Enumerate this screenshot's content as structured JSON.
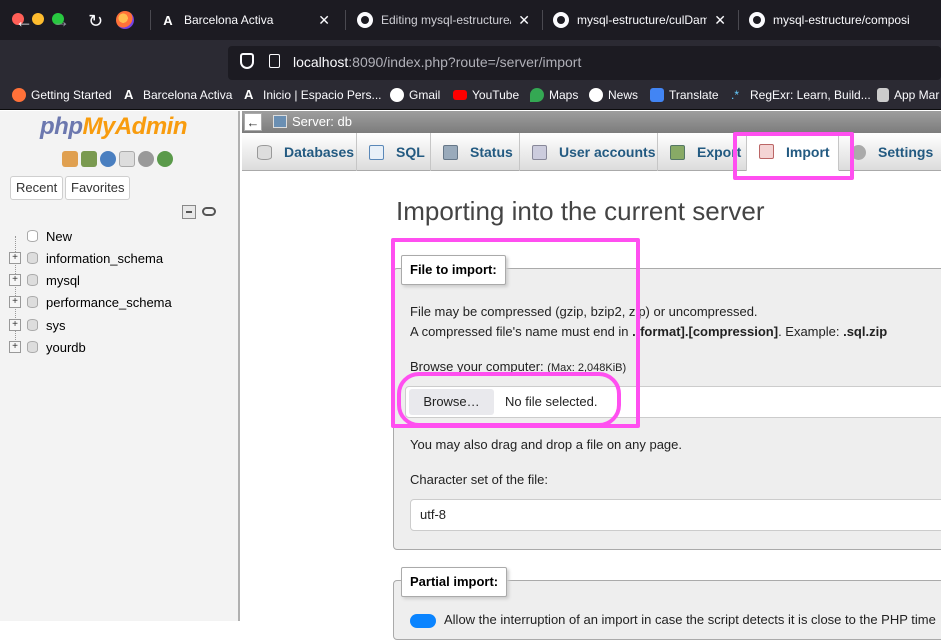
{
  "browser": {
    "tabs": [
      {
        "title": "Barcelona Activa"
      },
      {
        "title": "Editing mysql-estructure/R"
      },
      {
        "title": "mysql-estructure/culDamp"
      },
      {
        "title": "mysql-estructure/composi"
      }
    ],
    "url_host": "localhost",
    "url_rest": ":8090/index.php?route=/server/import",
    "bookmarks": [
      "Getting Started",
      "Barcelona Activa",
      "Inicio | Espacio Pers...",
      "Gmail",
      "YouTube",
      "Maps",
      "News",
      "Translate",
      "RegExr: Learn, Build...",
      "App Mar"
    ]
  },
  "sidebar": {
    "logo_php": "php",
    "logo_admin": "MyAdmin",
    "tabs": [
      "Recent",
      "Favorites"
    ],
    "tree": [
      "New",
      "information_schema",
      "mysql",
      "performance_schema",
      "sys",
      "yourdb"
    ]
  },
  "server_label": "Server: db",
  "menu": [
    "Databases",
    "SQL",
    "Status",
    "User accounts",
    "Export",
    "Import",
    "Settings"
  ],
  "page_title": "Importing into the current server",
  "file_import": {
    "legend": "File to import:",
    "compress_line": "File may be compressed (gzip, bzip2, zip) or uncompressed.",
    "name_line_pre": "A compressed file's name must end in ",
    "name_line_bold": ".[format].[compression]",
    "name_line_mid": ". Example: ",
    "name_line_example": ".sql.zip",
    "browse_label": "Browse your computer: ",
    "max_size": "(Max: 2,048KiB)",
    "browse_button": "Browse…",
    "no_file": "No file selected.",
    "drag_hint": "You may also drag and drop a file on any page.",
    "charset_label": "Character set of the file:",
    "charset_value": "utf-8"
  },
  "partial_import": {
    "legend": "Partial import:",
    "option_text": "Allow the interruption of an import in case the script detects it is close to the PHP time"
  }
}
